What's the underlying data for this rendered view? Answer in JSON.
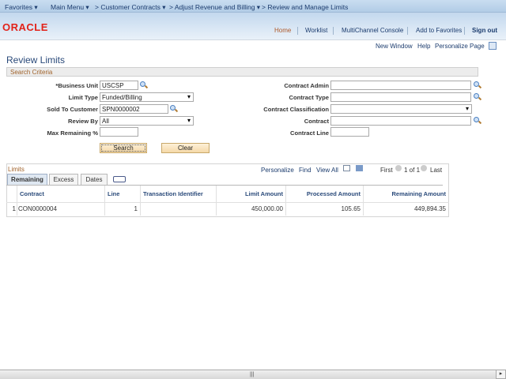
{
  "nav": {
    "favorites": "Favorites ▾",
    "main_menu": "Main Menu ▾",
    "crumb1": "> Customer Contracts ▾",
    "crumb2": "> Adjust Revenue and Billing ▾",
    "crumb3": "> Review and Manage Limits"
  },
  "header": {
    "logo": "ORACLE",
    "links": [
      "Home",
      "Worklist",
      "MultiChannel Console",
      "Add to Favorites",
      "Sign out"
    ]
  },
  "page_links": [
    "New Window",
    "Help",
    "Personalize Page"
  ],
  "title": "Review Limits",
  "search_criteria": {
    "title": "Search Criteria",
    "business_unit": {
      "label": "*Business Unit",
      "value": "USCSP"
    },
    "limit_type": {
      "label": "Limit Type",
      "value": "Funded/Billing"
    },
    "sold_to": {
      "label": "Sold To Customer",
      "value": "SPN0000002"
    },
    "review_by": {
      "label": "Review By",
      "value": "All"
    },
    "max_remaining": {
      "label": "Max Remaining %",
      "value": ""
    },
    "contract_admin": {
      "label": "Contract Admin",
      "value": ""
    },
    "contract_type": {
      "label": "Contract Type",
      "value": ""
    },
    "contract_class": {
      "label": "Contract Classification",
      "value": ""
    },
    "contract": {
      "label": "Contract",
      "value": ""
    },
    "contract_line": {
      "label": "Contract Line",
      "value": ""
    },
    "search": "Search",
    "clear": "Clear"
  },
  "grid": {
    "title": "Limits",
    "personalize": "Personalize",
    "find": "Find",
    "view_all": "View All",
    "first": "First",
    "pager": "1 of 1",
    "last": "Last",
    "tabs": [
      "Remaining",
      "Excess",
      "Dates"
    ],
    "columns": [
      "Contract",
      "Line",
      "Transaction Identifier",
      "Limit Amount",
      "Processed Amount",
      "Remaining Amount"
    ],
    "rows": [
      {
        "num": "1",
        "contract": "CON0000004",
        "line": "1",
        "txn": "",
        "limit": "450,000.00",
        "processed": "105.65",
        "remaining": "449,894.35"
      }
    ]
  }
}
